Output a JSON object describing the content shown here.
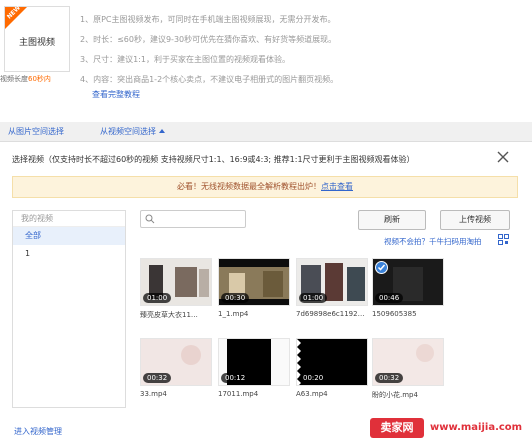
{
  "top": {
    "badge": "NEW",
    "card_title": "主图视频",
    "card_sub_prefix": "视频长度",
    "card_sub_value": "60秒内",
    "rules": [
      "1、原PC主图视频发布，可同时在手机端主图视频展现，无需分开发布。",
      "2、时长：≤60秒，建议9-30秒可优先在猜你喜欢、有好货等频道展现。",
      "3、尺寸：建议1:1，利于买家在主图位置的视频观看体验。",
      "4、内容：突出商品1-2个核心卖点，不建议电子相册式的图片翻页视频。"
    ],
    "tutorial_link": "查看完整教程"
  },
  "tabs": [
    {
      "label": "从图片空间选择"
    },
    {
      "label": "从视频空间选择"
    }
  ],
  "dialog": {
    "title": "选择视频（仅支持时长不超过60秒的视频 支持视频尺寸1:1、16:9或4:3; 推荐1:1尺寸更利于主图视频观看体验）",
    "notice_text": "必看！无线视频数据最全解析教程出炉！",
    "notice_link": "点击查看",
    "folder_header": "我的视频",
    "folders": [
      "全部",
      "1"
    ],
    "refresh_label": "刷新",
    "upload_label": "上传视频",
    "help_link": "视频不会拍？千牛扫码用淘拍",
    "manage_link": "进入视频管理"
  },
  "videos": [
    {
      "name": "臻亮皮草大衣11…",
      "duration": "01:00",
      "selected": false
    },
    {
      "name": "1_1.mp4",
      "duration": "00:30",
      "selected": false
    },
    {
      "name": "7d69898e6c1192…",
      "duration": "01:00",
      "selected": false
    },
    {
      "name": "1509605385",
      "duration": "00:46",
      "selected": true
    },
    {
      "name": "33.mp4",
      "duration": "00:32",
      "selected": false
    },
    {
      "name": "17011.mp4",
      "duration": "00:12",
      "selected": false
    },
    {
      "name": "A63.mp4",
      "duration": "00:20",
      "selected": false
    },
    {
      "name": "盼的小花.mp4",
      "duration": "00:32",
      "selected": false
    }
  ],
  "watermark": {
    "logo_text": "卖家网",
    "url": "www.maijia.com"
  },
  "colors": {
    "link": "#3366cc",
    "accent": "#ff6a00",
    "notice_bg": "#fdf3dc",
    "selected_check": "#3b82d8"
  }
}
